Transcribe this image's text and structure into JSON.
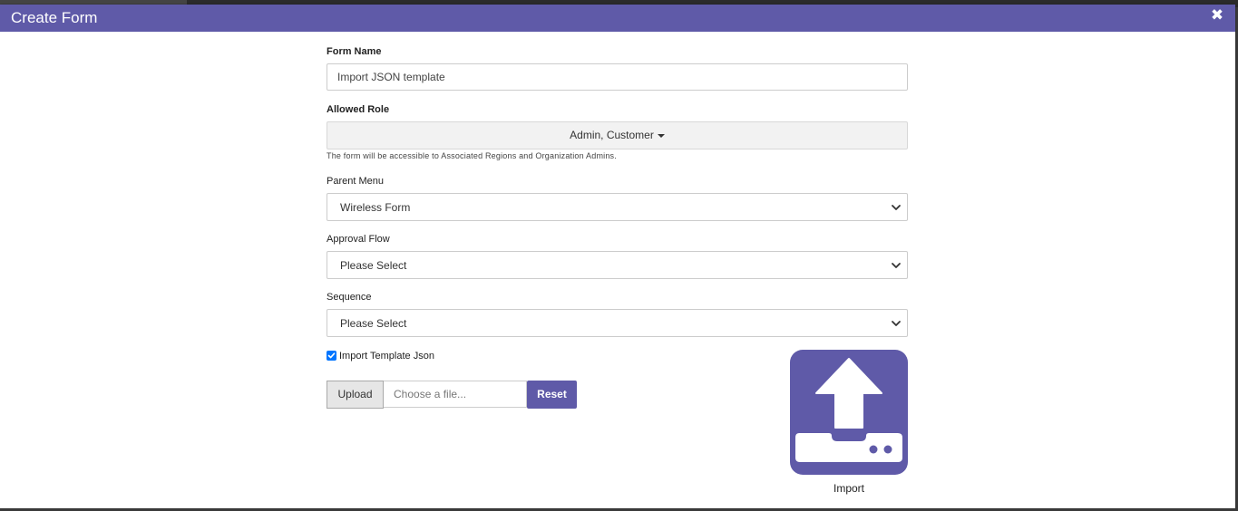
{
  "modal": {
    "title": "Create Form",
    "close_symbol": "✖"
  },
  "form": {
    "form_name_label": "Form Name",
    "form_name_value": "Import JSON template",
    "allowed_role_label": "Allowed Role",
    "allowed_role_value": "Admin, Customer",
    "allowed_role_help": "The form will be accessible to Associated Regions and Organization Admins.",
    "parent_menu_label": "Parent Menu",
    "parent_menu_value": "Wireless Form",
    "approval_flow_label": "Approval Flow",
    "approval_flow_value": "Please Select",
    "sequence_label": "Sequence",
    "sequence_value": "Please Select",
    "import_checkbox_label": "Import Template Json",
    "import_checkbox_checked": true
  },
  "upload": {
    "upload_label": "Upload",
    "file_placeholder": "Choose a file...",
    "reset_label": "Reset"
  },
  "import_tile": {
    "icon": "upload-tray-icon",
    "label": "Import"
  },
  "colors": {
    "accent": "#5f5aa8",
    "checkbox": "#0075ff"
  }
}
